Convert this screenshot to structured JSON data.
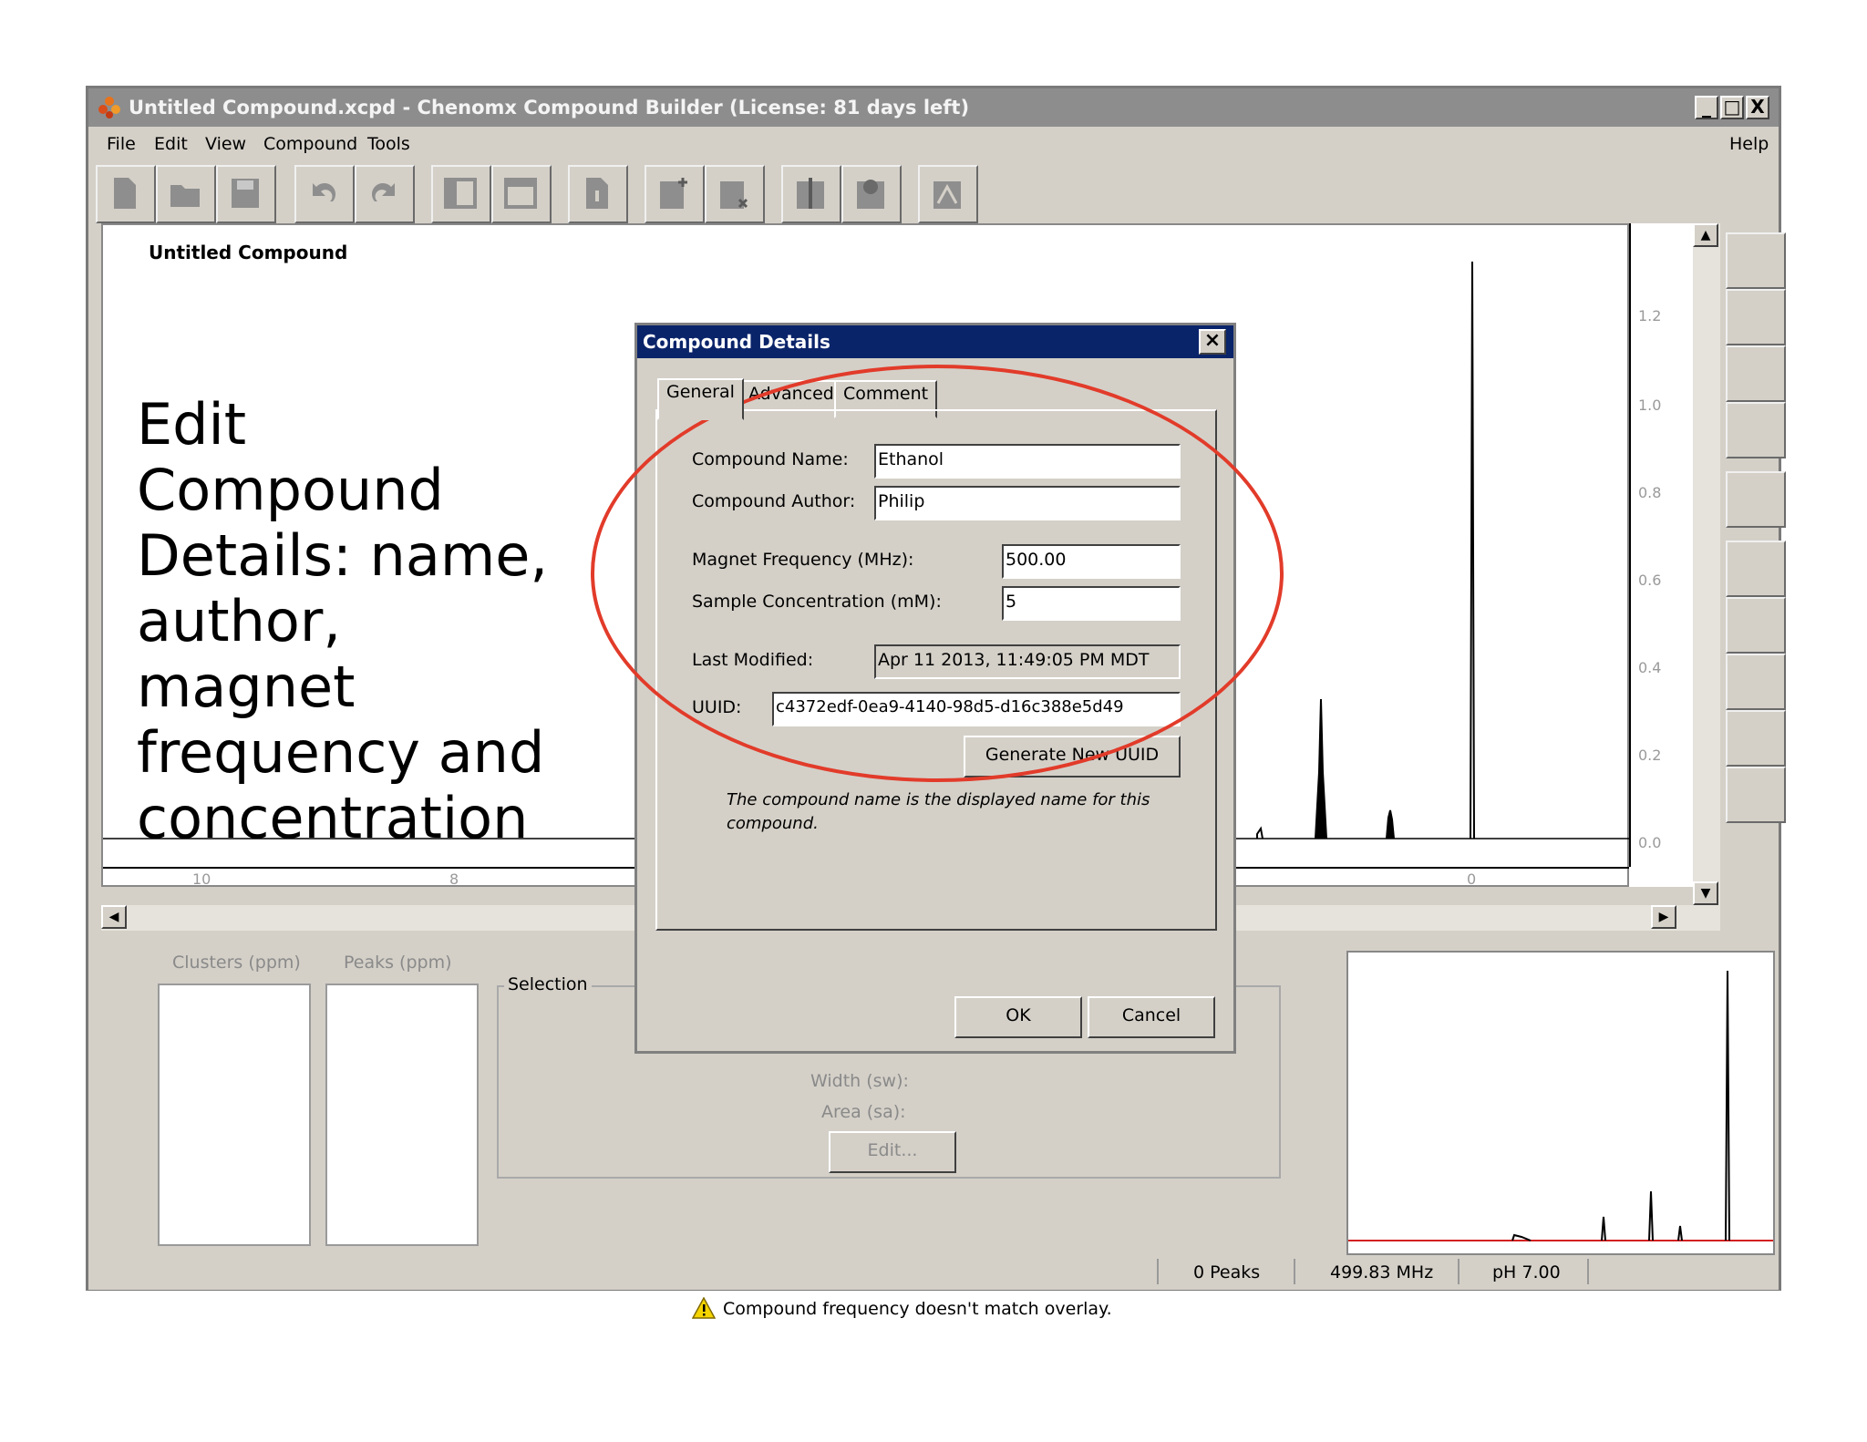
{
  "window": {
    "title": "Untitled Compound.xcpd - Chenomx Compound Builder (License: 81 days left)",
    "controls": {
      "minimize": "_",
      "maximize": "□",
      "close": "X"
    }
  },
  "menubar": {
    "items": [
      "File",
      "Edit",
      "View",
      "Compound",
      "Tools"
    ],
    "help": "Help"
  },
  "toolbar": {
    "icons": [
      "new-file-icon",
      "open-folder-icon",
      "save-icon",
      "undo-icon",
      "redo-icon",
      "layout-left-icon",
      "layout-right-icon",
      "info-icon",
      "add-cluster-icon",
      "remove-cluster-icon",
      "add-peak-icon",
      "remove-peak-icon",
      "fit-icon"
    ]
  },
  "spectrum": {
    "title": "Untitled Compound",
    "x_ticks": [
      "10",
      "8",
      "0"
    ],
    "y_ticks": [
      "1.2",
      "1.0",
      "0.8",
      "0.6",
      "0.4",
      "0.2",
      "0.0"
    ]
  },
  "right_tools": {
    "icons": [
      "fit-view-icon",
      "zoom-in-icon",
      "zoom-out-icon",
      "zoom-region-icon",
      "columns-icon",
      "pan-icon",
      "increase-height-icon",
      "decrease-height-icon",
      "expand-horizontal-icon",
      "contract-horizontal-icon"
    ]
  },
  "bottom_panel": {
    "clusters_label": "Clusters (ppm)",
    "peaks_label": "Peaks (ppm)",
    "selection_label": "Selection",
    "width_label": "Width (sw):",
    "area_label": "Area (sa):",
    "edit_button": "Edit...",
    "warning": "Compound frequency doesn't match overlay."
  },
  "statusbar": {
    "peaks": "0 Peaks",
    "frequency": "499.83 MHz",
    "ph": "pH 7.00"
  },
  "dialog": {
    "title": "Compound Details",
    "tabs": [
      "General",
      "Advanced",
      "Comment"
    ],
    "active_tab": "General",
    "fields": {
      "compound_name": {
        "label": "Compound Name:",
        "value": "Ethanol"
      },
      "compound_author": {
        "label": "Compound Author:",
        "value": "Philip"
      },
      "magnet_frequency": {
        "label": "Magnet Frequency (MHz):",
        "value": "500.00"
      },
      "sample_concentration": {
        "label": "Sample Concentration (mM):",
        "value": "5"
      },
      "last_modified": {
        "label": "Last Modified:",
        "value": "Apr 11 2013, 11:49:05 PM MDT"
      },
      "uuid": {
        "label": "UUID:",
        "value": "c4372edf-0ea9-4140-98d5-d16c388e5d49"
      }
    },
    "generate_uuid_button": "Generate New UUID",
    "hint": "The compound name is the displayed name for this compound.",
    "ok_button": "OK",
    "cancel_button": "Cancel"
  },
  "annotation": {
    "text": "Edit\nCompound\nDetails:  name,\nauthor,\nmagnet\nfrequency and\nconcentration",
    "highlight_color": "#e23b2a"
  },
  "colors": {
    "window_bg": "#d4d0c8",
    "dialog_title_bg": "#0a246a",
    "overlay_baseline": "#d32020"
  }
}
